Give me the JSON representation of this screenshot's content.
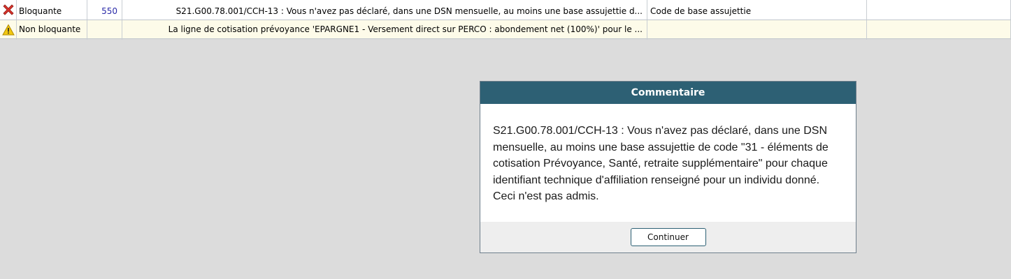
{
  "grid": {
    "rows": [
      {
        "icon": "error-x-icon",
        "severity": "Bloquante",
        "number": "550",
        "message": "S21.G00.78.001/CCH-13 : Vous n'avez pas déclaré, dans une DSN mensuelle, au moins une base assujettie d...",
        "code": "Code de base assujettie",
        "extra": ""
      },
      {
        "icon": "warning-triangle-icon",
        "severity": "Non bloquante",
        "number": "",
        "message": "La ligne de cotisation prévoyance 'EPARGNE1 - Versement direct sur PERCO : abondement net (100%)' pour le ...",
        "code": "",
        "extra": ""
      }
    ]
  },
  "dialog": {
    "title": "Commentaire",
    "body": "S21.G00.78.001/CCH-13 : Vous n'avez pas déclaré, dans une DSN mensuelle, au moins une base assujettie de code \"31 - éléments de cotisation Prévoyance, Santé, retraite supplémentaire\" pour chaque identifiant technique d'affiliation renseigné pour un individu donné. Ceci n'est pas admis.",
    "button_label": "Continuer"
  },
  "colors": {
    "header": "#2d6074",
    "error": "#d9322b",
    "warning": "#f2c80f",
    "number": "#2a2aa8"
  }
}
